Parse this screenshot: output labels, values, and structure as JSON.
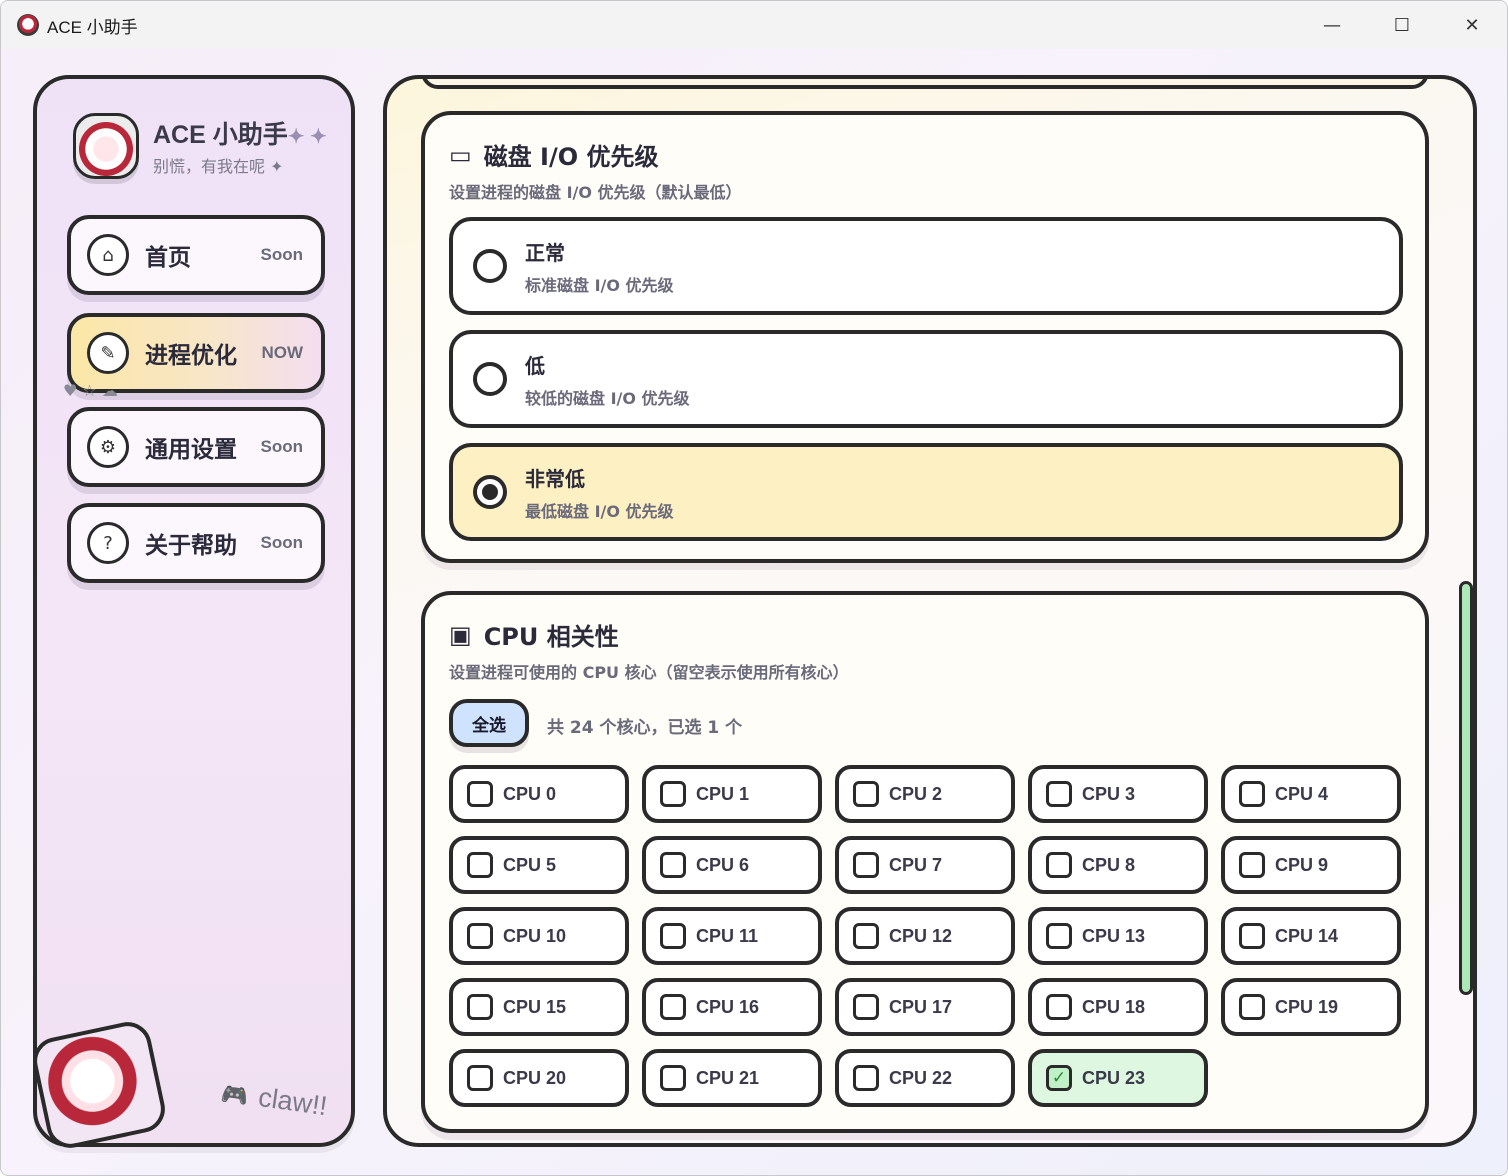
{
  "window": {
    "title": "ACE 小助手",
    "minimize": "—",
    "maximize": "☐",
    "close": "✕"
  },
  "brand": {
    "title": "ACE 小助手",
    "sparkles": "✦ ✦",
    "subtitle": "别慌，有我在呢 ✦"
  },
  "nav": [
    {
      "label": "首页",
      "badge": "Soon",
      "icon": "home-icon",
      "glyph": "⌂",
      "active": false
    },
    {
      "label": "进程优化",
      "badge": "NOW",
      "icon": "wrench-icon",
      "glyph": "✎",
      "active": true
    },
    {
      "label": "通用设置",
      "badge": "Soon",
      "icon": "gear-icon",
      "glyph": "⚙",
      "active": false
    },
    {
      "label": "关于帮助",
      "badge": "Soon",
      "icon": "help-icon",
      "glyph": "?",
      "active": false
    }
  ],
  "decor": {
    "hearts": "♥ ☆ ☁",
    "claw": "claw!!",
    "pad_glyph": "🎮"
  },
  "disk_io": {
    "title": "磁盘 I/O 优先级",
    "icon_glyph": "▭",
    "description": "设置进程的磁盘 I/O 优先级（默认最低）",
    "options": [
      {
        "label": "正常",
        "sub": "标准磁盘 I/O 优先级",
        "selected": false
      },
      {
        "label": "低",
        "sub": "较低的磁盘 I/O 优先级",
        "selected": false
      },
      {
        "label": "非常低",
        "sub": "最低磁盘 I/O 优先级",
        "selected": true
      }
    ]
  },
  "cpu": {
    "title": "CPU 相关性",
    "icon_glyph": "▣",
    "description": "设置进程可使用的 CPU 核心（留空表示使用所有核心）",
    "select_all": "全选",
    "count_text": "共 24 个核心，已选 1 个",
    "cores": [
      {
        "label": "CPU 0",
        "checked": false
      },
      {
        "label": "CPU 1",
        "checked": false
      },
      {
        "label": "CPU 2",
        "checked": false
      },
      {
        "label": "CPU 3",
        "checked": false
      },
      {
        "label": "CPU 4",
        "checked": false
      },
      {
        "label": "CPU 5",
        "checked": false
      },
      {
        "label": "CPU 6",
        "checked": false
      },
      {
        "label": "CPU 7",
        "checked": false
      },
      {
        "label": "CPU 8",
        "checked": false
      },
      {
        "label": "CPU 9",
        "checked": false
      },
      {
        "label": "CPU 10",
        "checked": false
      },
      {
        "label": "CPU 11",
        "checked": false
      },
      {
        "label": "CPU 12",
        "checked": false
      },
      {
        "label": "CPU 13",
        "checked": false
      },
      {
        "label": "CPU 14",
        "checked": false
      },
      {
        "label": "CPU 15",
        "checked": false
      },
      {
        "label": "CPU 16",
        "checked": false
      },
      {
        "label": "CPU 17",
        "checked": false
      },
      {
        "label": "CPU 18",
        "checked": false
      },
      {
        "label": "CPU 19",
        "checked": false
      },
      {
        "label": "CPU 20",
        "checked": false
      },
      {
        "label": "CPU 21",
        "checked": false
      },
      {
        "label": "CPU 22",
        "checked": false
      },
      {
        "label": "CPU 23",
        "checked": true
      }
    ]
  },
  "colors": {
    "accent_yellow": "#fdf0c2",
    "accent_green": "#ddf7e0",
    "accent_blue": "#cfe3ff",
    "border": "#2a2a2a"
  }
}
